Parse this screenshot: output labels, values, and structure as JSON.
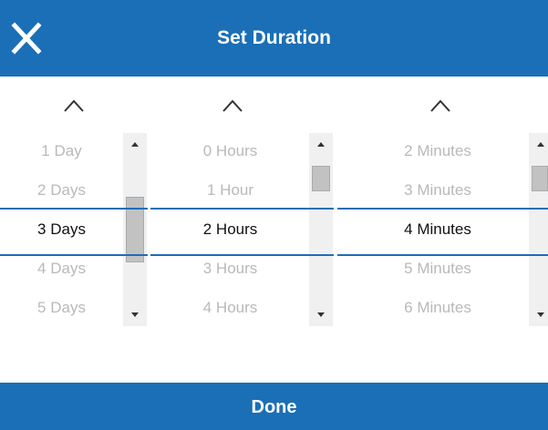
{
  "header": {
    "title": "Set Duration",
    "close_icon": "close-icon",
    "background": "#1b6fb6"
  },
  "pickers": {
    "days": {
      "items": [
        "1 Day",
        "2 Days",
        "3 Days",
        "4 Days",
        "5 Days"
      ],
      "selected": "3 Days"
    },
    "hours": {
      "items": [
        "0 Hours",
        "1 Hour",
        "2 Hours",
        "3 Hours",
        "4 Hours"
      ],
      "selected": "2 Hours"
    },
    "minutes": {
      "items": [
        "2 Minutes",
        "3 Minutes",
        "4 Minutes",
        "5 Minutes",
        "6 Minutes"
      ],
      "selected": "4 Minutes"
    }
  },
  "footer": {
    "done_label": "Done"
  },
  "colors": {
    "accent": "#1b6fb6",
    "inactive_text": "#b9b9b9",
    "selected_text": "#111111"
  }
}
